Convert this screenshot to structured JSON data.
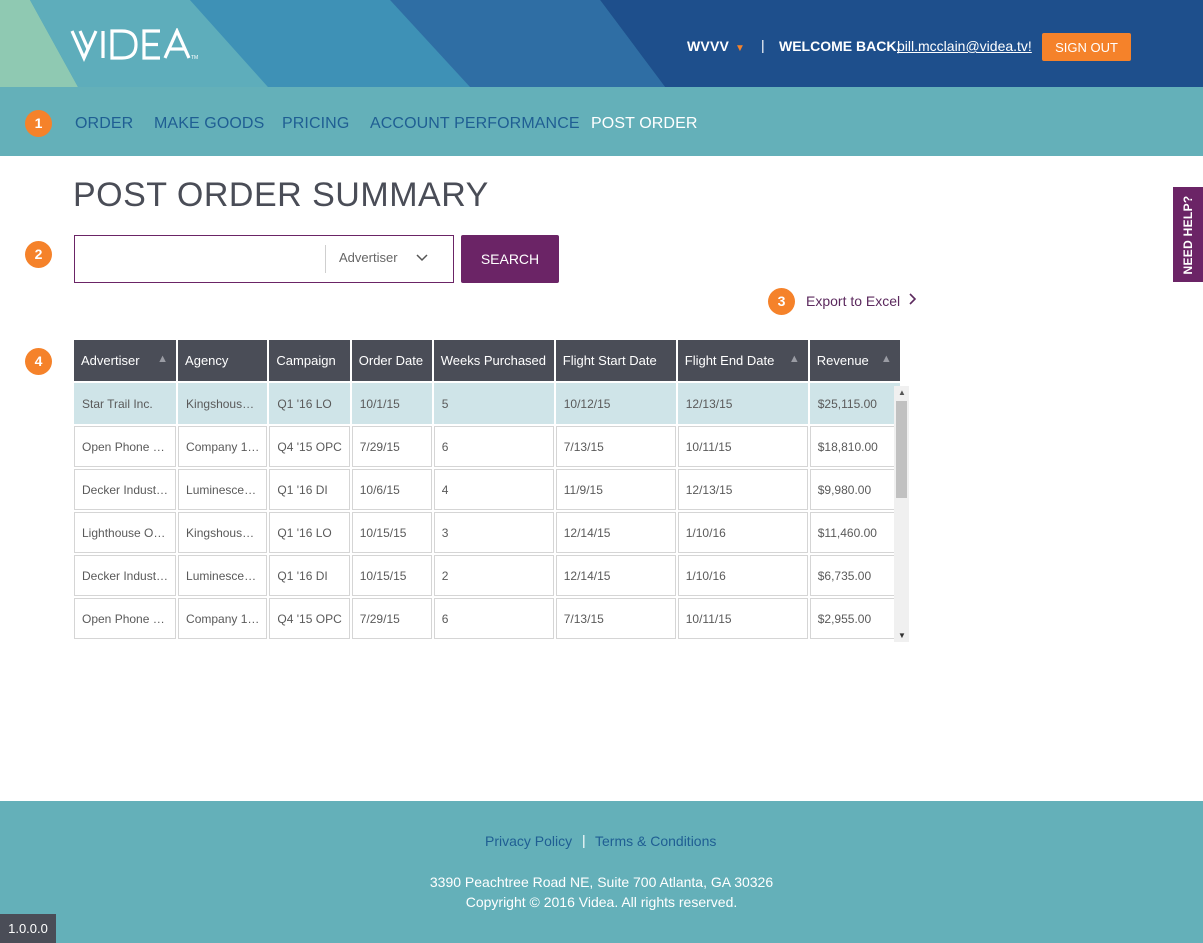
{
  "header": {
    "logo_text": "VIDEA",
    "station": "WVVV",
    "separator": "|",
    "welcome": "WELCOME BACK,",
    "email": "bill.mcclain@videa.tv!",
    "sign_out": "SIGN OUT"
  },
  "nav": {
    "items": [
      {
        "label": "ORDER"
      },
      {
        "label": "MAKE GOODS"
      },
      {
        "label": "PRICING"
      },
      {
        "label": "ACCOUNT PERFORMANCE"
      },
      {
        "label": "POST ORDER"
      }
    ],
    "active": "POST ORDER"
  },
  "badges": [
    "1",
    "2",
    "3",
    "4"
  ],
  "page": {
    "title": "POST ORDER SUMMARY",
    "search": {
      "value": "",
      "placeholder": "",
      "filter_selected": "Advertiser",
      "button": "SEARCH"
    },
    "export_label": "Export to Excel",
    "help_label": "NEED HELP?"
  },
  "table": {
    "columns": [
      "Advertiser",
      "Agency",
      "Campaign",
      "Order Date",
      "Weeks Purchased",
      "Flight Start Date",
      "Flight End Date",
      "Revenue"
    ],
    "sortable": [
      true,
      false,
      false,
      false,
      false,
      false,
      true,
      true
    ],
    "rows": [
      [
        "Star Trail Inc.",
        "Kingshous…",
        "Q1 '16 LO",
        "10/1/15",
        "5",
        "10/12/15",
        "12/13/15",
        "$25,115.00"
      ],
      [
        "Open Phone …",
        "Company 1…",
        "Q4 '15 OPC",
        "7/29/15",
        "6",
        "7/13/15",
        "10/11/15",
        "$18,810.00"
      ],
      [
        "Decker Indust…",
        "Luminesce…",
        "Q1 '16 DI",
        "10/6/15",
        "4",
        "11/9/15",
        "12/13/15",
        "$9,980.00"
      ],
      [
        "Lighthouse O…",
        "Kingshous…",
        "Q1 '16 LO",
        "10/15/15",
        "3",
        "12/14/15",
        "1/10/16",
        "$11,460.00"
      ],
      [
        "Decker Indust…",
        "Luminesce…",
        "Q1 '16 DI",
        "10/15/15",
        "2",
        "12/14/15",
        "1/10/16",
        "$6,735.00"
      ],
      [
        "Open Phone …",
        "Company 1…",
        "Q4 '15 OPC",
        "7/29/15",
        "6",
        "7/13/15",
        "10/11/15",
        "$2,955.00"
      ]
    ],
    "selected_row": 0
  },
  "footer": {
    "privacy": "Privacy Policy",
    "separator": "|",
    "terms": "Terms & Conditions",
    "address": "3390 Peachtree Road NE, Suite 700 Atlanta, GA 30326",
    "copyright": "Copyright © 2016 Videa. All rights reserved."
  },
  "version": "1.0.0.0",
  "colors": {
    "header_dark": "#1e4f8c",
    "nav_teal": "#64b0b9",
    "accent_orange": "#f5822a",
    "purple": "#6b2466",
    "table_header": "#4a4d57",
    "selected_row": "#cfe4e8"
  },
  "icons": {
    "station_caret": "chevron-down-icon",
    "select_caret": "chevron-down-icon",
    "export": "chevron-right-icon",
    "sort": "caret-up-icon"
  }
}
